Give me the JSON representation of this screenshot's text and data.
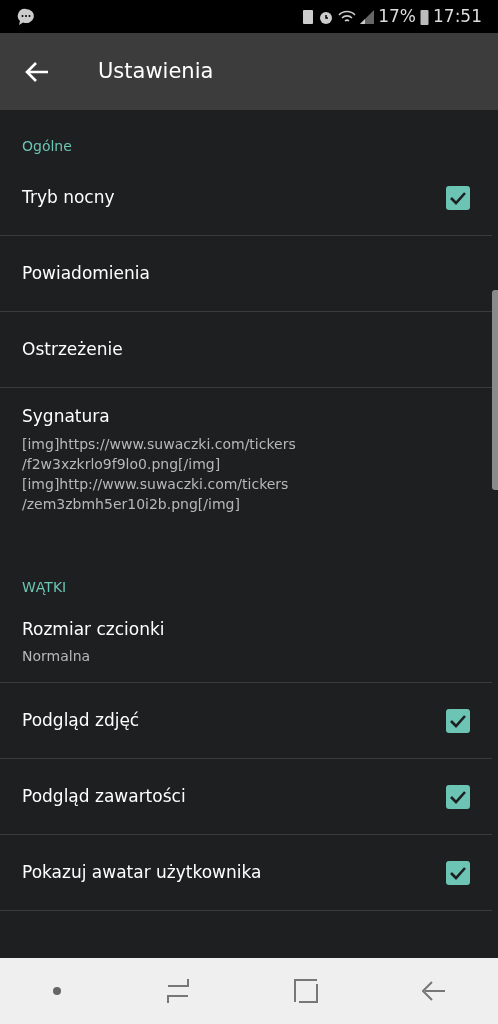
{
  "status_bar": {
    "battery": "17%",
    "time": "17:51"
  },
  "toolbar": {
    "title": "Ustawienia"
  },
  "sections": [
    {
      "header": "Ogólne",
      "items": [
        {
          "kind": "checkbox",
          "title": "Tryb nocny",
          "checked": true
        },
        {
          "kind": "plain",
          "title": "Powiadomienia"
        },
        {
          "kind": "plain",
          "title": "Ostrzeżenie"
        },
        {
          "kind": "summary",
          "title": "Sygnatura",
          "summary": "[img]https://www.suwaczki.com/tickers\n/f2w3xzkrlo9f9lo0.png[/img]\n[img]http://www.suwaczki.com/tickers\n/zem3zbmh5er10i2b.png[/img]"
        }
      ]
    },
    {
      "header": "WĄTKI",
      "items": [
        {
          "kind": "summary",
          "title": "Rozmiar czcionki",
          "summary": "Normalna"
        },
        {
          "kind": "checkbox",
          "title": "Podgląd zdjęć",
          "checked": true
        },
        {
          "kind": "checkbox",
          "title": "Podgląd zawartości",
          "checked": true
        },
        {
          "kind": "checkbox",
          "title": "Pokazuj awatar użytkownika",
          "checked": true
        }
      ]
    }
  ]
}
